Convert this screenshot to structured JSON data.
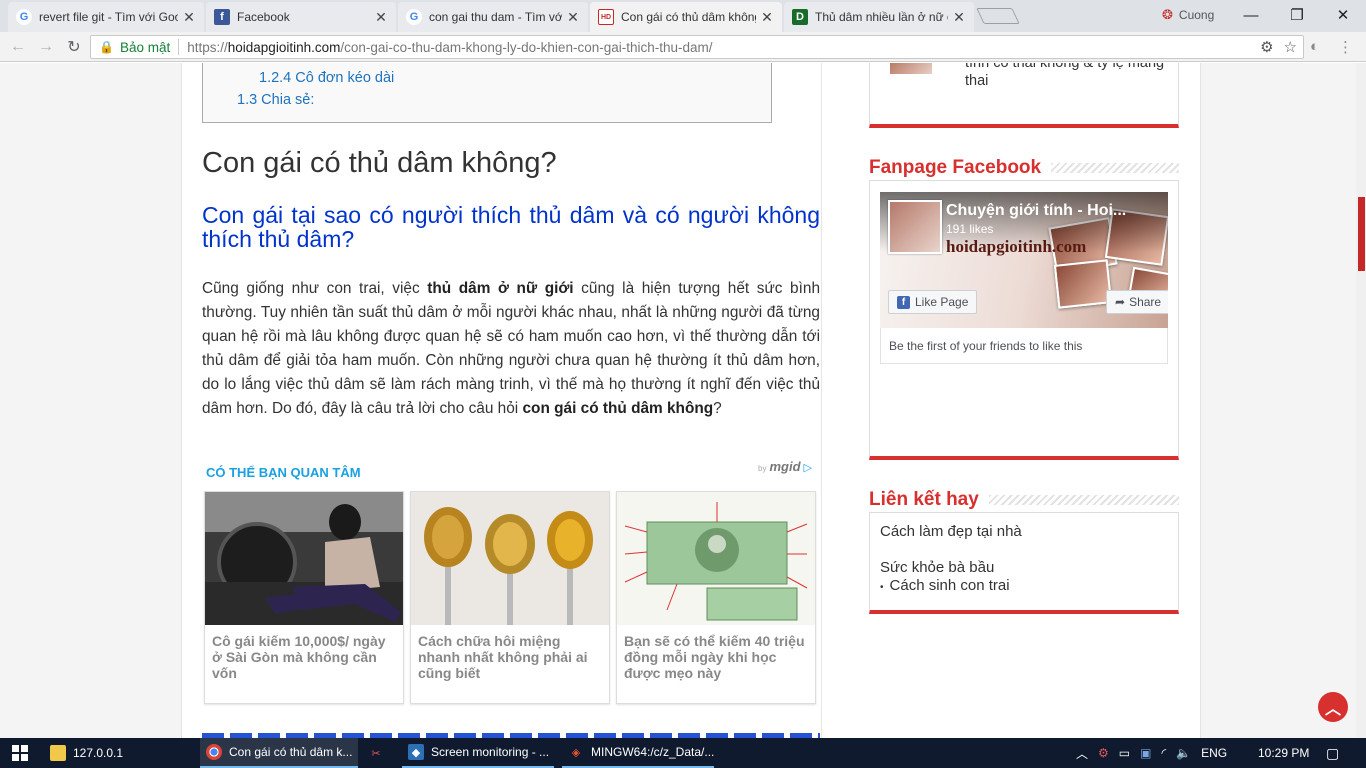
{
  "browser": {
    "tabs": [
      {
        "title": "revert file git - Tìm với Google",
        "icon": "google-icon"
      },
      {
        "title": "Facebook",
        "icon": "facebook-icon"
      },
      {
        "title": "con gai thu dam - Tìm với Google",
        "icon": "google-icon"
      },
      {
        "title": "Con gái có thủ dâm không",
        "icon": "hoidapgioitinh-icon"
      },
      {
        "title": "Thủ dâm nhiều lần ở nữ giới",
        "icon": "d-site-icon"
      }
    ],
    "profile_name": "Cuong",
    "security_label": "Bảo mật",
    "url_scheme": "https://",
    "url_host": "hoidapgioitinh.com",
    "url_path": "/con-gai-co-thu-dam-khong-ly-do-khien-con-gai-thich-thu-dam/"
  },
  "article": {
    "toc": [
      {
        "label": "1.2.4 Cô đơn kéo dài"
      },
      {
        "label": "1.3 Chia sẻ:"
      }
    ],
    "heading": "Con gái có thủ dâm không?",
    "subheading": "Con gái tại sao có người thích thủ dâm và có người không thích thủ dâm?",
    "para_1": "Cũng giống như con trai, việc ",
    "para_bold_1": "thủ dâm ở nữ giới",
    "para_2": " cũng là hiện tượng hết sức bình thường. Tuy nhiên tần suất thủ dâm ở mỗi người khác nhau, nhất là những người đã từng quan hệ rồi mà lâu không được quan hệ sẽ có ham muốn cao hơn, vì thế thường dẫn tới thủ dâm để giải tỏa ham muốn. Còn những người chưa quan hệ thường ít thủ dâm hơn, do lo lắng việc thủ dâm sẽ làm rách màng trinh, vì thế mà họ thường ít nghĩ đến việc thủ dâm hơn. Do đó, đây là câu trả lời cho câu hỏi ",
    "para_bold_2": "con gái có thủ dâm không",
    "para_3": "?"
  },
  "recommend": {
    "heading": "CÓ THỂ BẠN QUAN TÂM",
    "by": "by",
    "brand": "mgid",
    "cards": [
      {
        "caption": "Cô gái kiếm 10,000$/ ngày ở Sài Gòn mà không cần vốn"
      },
      {
        "caption": "Cách chữa hôi miệng nhanh nhất không phải ai cũng biết"
      },
      {
        "caption": "Bạn sẽ có thể kiếm 40 triệu đồng mỗi ngày khi học được mẹo này"
      }
    ]
  },
  "sidebar": {
    "post_title": "tình có thai không & tỷ lệ mang thai",
    "fanpage_title": "Fanpage Facebook",
    "fb": {
      "page_name": "Chuyện giới tính - Hoi...",
      "likes": "191 likes",
      "watermark": "hoidapgioitinh.com",
      "like_label": "Like Page",
      "share_label": "Share",
      "friends_text": "Be the first of your friends to like this"
    },
    "links_title": "Liên kết hay",
    "links": [
      "Cách làm đẹp tại nhà",
      "Sức khỏe bà bầu",
      "Cách sinh con trai"
    ]
  },
  "taskbar": {
    "items": [
      {
        "label": "127.0.0.1",
        "icon": "folder-icon"
      },
      {
        "label": "Con gái có thủ dâm k...",
        "icon": "chrome-icon"
      },
      {
        "label": "",
        "icon": "snipping-tool-icon"
      },
      {
        "label": "Screen monitoring - ...",
        "icon": "virtualbox-icon"
      },
      {
        "label": "MINGW64:/c/z_Data/...",
        "icon": "git-bash-icon"
      }
    ],
    "language": "ENG",
    "time": "10:29 PM"
  },
  "colors": {
    "accent_red": "#d7302e",
    "link_blue": "#1e73be",
    "heading_blue": "#0033cc",
    "mgid_blue": "#1aa1e1"
  }
}
